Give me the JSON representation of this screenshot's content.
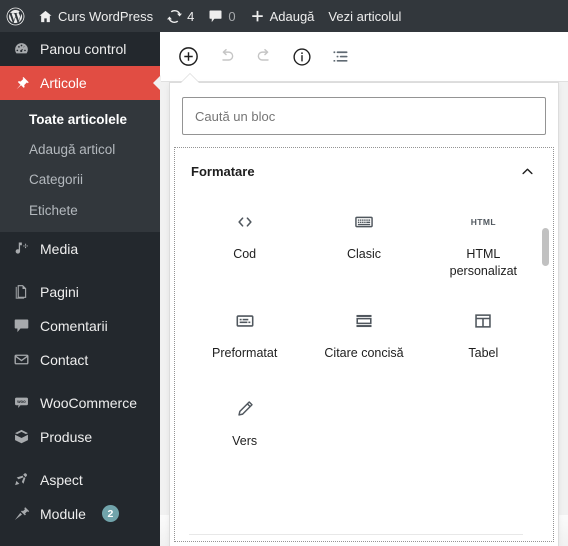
{
  "adminbar": {
    "logo_icon": "wordpress-logo-icon",
    "site_icon": "home-icon",
    "site_name": "Curs WordPress",
    "updates_icon": "updates-icon",
    "updates_count": "4",
    "comments_icon": "comment-bubble-icon",
    "comments_count": "0",
    "new_icon": "plus-icon",
    "new_label": "Adaugă",
    "view_label": "Vezi articolul"
  },
  "sidebar": {
    "accent_color": "#e14d43",
    "background_color": "#23282d",
    "submenu_background": "#32373c",
    "items": [
      {
        "label": "Panou control",
        "icon": "dashboard-icon",
        "current": false
      },
      {
        "label": "Articole",
        "icon": "pin-icon",
        "current": true
      },
      {
        "label": "Media",
        "icon": "media-icon",
        "current": false
      },
      {
        "label": "Pagini",
        "icon": "pages-icon",
        "current": false
      },
      {
        "label": "Comentarii",
        "icon": "comment-icon",
        "current": false
      },
      {
        "label": "Contact",
        "icon": "envelope-icon",
        "current": false
      },
      {
        "label": "WooCommerce",
        "icon": "woocommerce-icon",
        "current": false
      },
      {
        "label": "Produse",
        "icon": "product-box-icon",
        "current": false
      },
      {
        "label": "Aspect",
        "icon": "appearance-brush-icon",
        "current": false
      },
      {
        "label": "Module",
        "icon": "plugin-plug-icon",
        "current": false,
        "badge": "2"
      }
    ],
    "submenu": [
      {
        "label": "Toate articolele",
        "current": true
      },
      {
        "label": "Adaugă articol",
        "current": false
      },
      {
        "label": "Categorii",
        "current": false
      },
      {
        "label": "Etichete",
        "current": false
      }
    ]
  },
  "toolbar": {
    "buttons": [
      {
        "name": "add-block-button",
        "icon": "plus-circle-icon",
        "disabled": false
      },
      {
        "name": "undo-button",
        "icon": "undo-icon",
        "disabled": true
      },
      {
        "name": "redo-button",
        "icon": "redo-icon",
        "disabled": true
      },
      {
        "name": "details-button",
        "icon": "info-circle-icon",
        "disabled": false
      },
      {
        "name": "list-view-button",
        "icon": "list-view-icon",
        "disabled": false
      }
    ]
  },
  "inserter": {
    "search": {
      "placeholder": "Caută un bloc",
      "value": ""
    },
    "category": {
      "title": "Formatare",
      "collapse_icon": "chevron-up-icon",
      "expanded": true
    },
    "blocks": [
      {
        "label": "Cod",
        "icon": "code-brackets-icon"
      },
      {
        "label": "Clasic",
        "icon": "keyboard-icon"
      },
      {
        "label": "HTML personalizat",
        "icon": "html-tag-icon",
        "icon_text": "HTML"
      },
      {
        "label": "Preformatat",
        "icon": "preformatted-icon"
      },
      {
        "label": "Citare concisă",
        "icon": "pullquote-icon"
      },
      {
        "label": "Tabel",
        "icon": "table-icon"
      },
      {
        "label": "Vers",
        "icon": "pencil-icon"
      }
    ]
  }
}
